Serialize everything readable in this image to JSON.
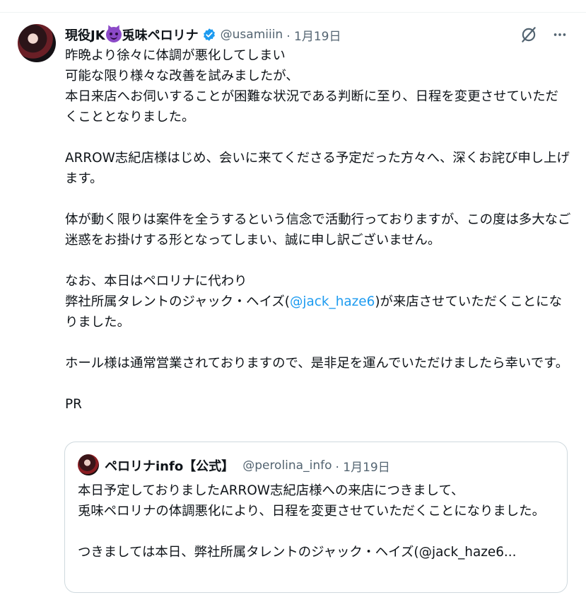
{
  "tweet": {
    "author_name": "現役JK",
    "author_name_suffix": "兎味ペロリナ",
    "emoji_icon": "smiling-devil-emoji",
    "verified_icon": "verified-badge-icon",
    "handle": "@usamiiin",
    "date": "· 1月19日",
    "body_lines_1": "昨晩より徐々に体調が悪化してしまい\n可能な限り様々な改善を試みましたが、\n本日来店へお伺いすることが困難な状況である判断に至り、日程を変更させていただくこととなりました。\n\nARROW志紀店様はじめ、会いに来てくださる予定だった方々へ、深くお詫び申し上げます。\n\n体が動く限りは案件を全うするという信念で活動行っておりますが、この度は多大なご迷惑をお掛けする形となってしまい、誠に申し訳ございません。\n\nなお、本日はペロリナに代わり\n弊社所属タレントのジャック・ヘイズ(",
    "mention": "@jack_haze6",
    "body_lines_2": ")が来店させていただくことになりました。\n\nホール様は通常営業されておりますので、是非足を運んでいただけましたら幸いです。\n\nPR"
  },
  "actions": {
    "grok_icon": "grok-icon",
    "more_icon": "more-options-icon"
  },
  "quote": {
    "author_name": "ペロリナinfo【公式】",
    "handle": "@perolina_info",
    "date": "· 1月19日",
    "body": "本日予定しておりましたARROW志紀店様への来店につきまして、\n兎味ペロリナの体調悪化により、日程を変更させていただくことになりました。\n\nつきましては本日、弊社所属タレントのジャック・ヘイズ(@jack_haze6..."
  },
  "colors": {
    "text": "#0f1419",
    "secondary": "#536471",
    "link": "#1d9bf0",
    "verified": "#1d9bf0",
    "border": "#cfd9de"
  }
}
